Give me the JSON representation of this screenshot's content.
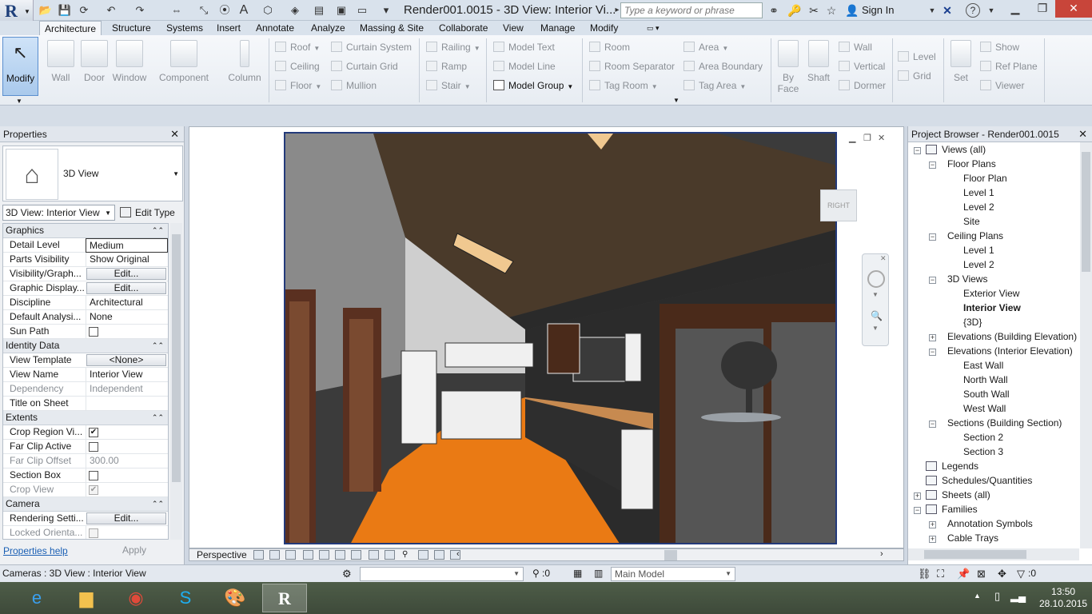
{
  "titlebar": {
    "app_letter": "R",
    "document_title": "Render001.0015 - 3D View: Interior Vi...",
    "search_placeholder": "Type a keyword or phrase",
    "sign_in": "Sign In",
    "help": "?"
  },
  "tabs": [
    "Architecture",
    "Structure",
    "Systems",
    "Insert",
    "Annotate",
    "Analyze",
    "Massing & Site",
    "Collaborate",
    "View",
    "Manage",
    "Modify"
  ],
  "ribbon": {
    "modify": "Modify",
    "wall": "Wall",
    "door": "Door",
    "window": "Window",
    "component": "Component",
    "column": "Column",
    "roof": "Roof",
    "ceiling": "Ceiling",
    "floor": "Floor",
    "curtain_system": "Curtain System",
    "curtain_grid": "Curtain Grid",
    "mullion": "Mullion",
    "railing": "Railing",
    "ramp": "Ramp",
    "stair": "Stair",
    "model_text": "Model Text",
    "model_line": "Model Line",
    "model_group": "Model Group",
    "room": "Room",
    "room_separator": "Room Separator",
    "tag_room": "Tag Room",
    "area": "Area",
    "area_boundary": "Area Boundary",
    "tag_area": "Tag Area",
    "by_face": "By Face",
    "shaft": "Shaft",
    "wall_opening": "Wall",
    "vertical": "Vertical",
    "dormer": "Dormer",
    "level": "Level",
    "grid": "Grid",
    "set": "Set",
    "show": "Show",
    "ref_plane": "Ref Plane",
    "viewer": "Viewer"
  },
  "properties": {
    "title": "Properties",
    "type_name": "3D View",
    "view_selector": "3D View: Interior View",
    "edit_type": "Edit Type",
    "sections": {
      "graphics": "Graphics",
      "identity": "Identity Data",
      "extents": "Extents",
      "camera": "Camera"
    },
    "rows": {
      "detail_level": {
        "k": "Detail Level",
        "v": "Medium"
      },
      "parts_visibility": {
        "k": "Parts Visibility",
        "v": "Show Original"
      },
      "visibility_graphics": {
        "k": "Visibility/Graph...",
        "v": "Edit..."
      },
      "graphic_display": {
        "k": "Graphic Display...",
        "v": "Edit..."
      },
      "discipline": {
        "k": "Discipline",
        "v": "Architectural"
      },
      "default_analysis": {
        "k": "Default Analysi...",
        "v": "None"
      },
      "sun_path": {
        "k": "Sun Path",
        "v": ""
      },
      "view_template": {
        "k": "View Template",
        "v": "<None>"
      },
      "view_name": {
        "k": "View Name",
        "v": "Interior View"
      },
      "dependency": {
        "k": "Dependency",
        "v": "Independent"
      },
      "title_on_sheet": {
        "k": "Title on Sheet",
        "v": ""
      },
      "crop_region": {
        "k": "Crop Region Vi...",
        "v": "✔"
      },
      "far_clip_active": {
        "k": "Far Clip Active",
        "v": ""
      },
      "far_clip_offset": {
        "k": "Far Clip Offset",
        "v": "300.00"
      },
      "section_box": {
        "k": "Section Box",
        "v": ""
      },
      "crop_view": {
        "k": "Crop View",
        "v": "✔"
      },
      "rendering_settings": {
        "k": "Rendering Setti...",
        "v": "Edit..."
      },
      "locked_orientation": {
        "k": "Locked Orienta...",
        "v": ""
      }
    },
    "help_link": "Properties help",
    "apply": "Apply"
  },
  "view": {
    "viewcube_label": "RIGHT",
    "perspective": "Perspective"
  },
  "project_browser": {
    "title": "Project Browser - Render001.0015",
    "nodes": [
      {
        "label": "Views (all)"
      },
      {
        "label": "Floor Plans"
      },
      {
        "label": "Floor Plan"
      },
      {
        "label": "Level 1"
      },
      {
        "label": "Level 2"
      },
      {
        "label": "Site"
      },
      {
        "label": "Ceiling Plans"
      },
      {
        "label": "Level 1"
      },
      {
        "label": "Level 2"
      },
      {
        "label": "3D Views"
      },
      {
        "label": "Exterior View"
      },
      {
        "label": "Interior View"
      },
      {
        "label": "{3D}"
      },
      {
        "label": "Elevations (Building Elevation)"
      },
      {
        "label": "Elevations (Interior Elevation)"
      },
      {
        "label": "East Wall"
      },
      {
        "label": "North Wall"
      },
      {
        "label": "South Wall"
      },
      {
        "label": "West Wall"
      },
      {
        "label": "Sections (Building Section)"
      },
      {
        "label": "Section 2"
      },
      {
        "label": "Section 3"
      },
      {
        "label": "Legends"
      },
      {
        "label": "Schedules/Quantities"
      },
      {
        "label": "Sheets (all)"
      },
      {
        "label": "Families"
      },
      {
        "label": "Annotation Symbols"
      },
      {
        "label": "Cable Trays"
      }
    ]
  },
  "statusbar": {
    "status_text": "Cameras : 3D View : Interior View",
    "selection_count": ":0",
    "model": "Main Model",
    "filter_count": ":0"
  },
  "taskbar": {
    "time": "13:50",
    "date": "28.10.2015"
  }
}
